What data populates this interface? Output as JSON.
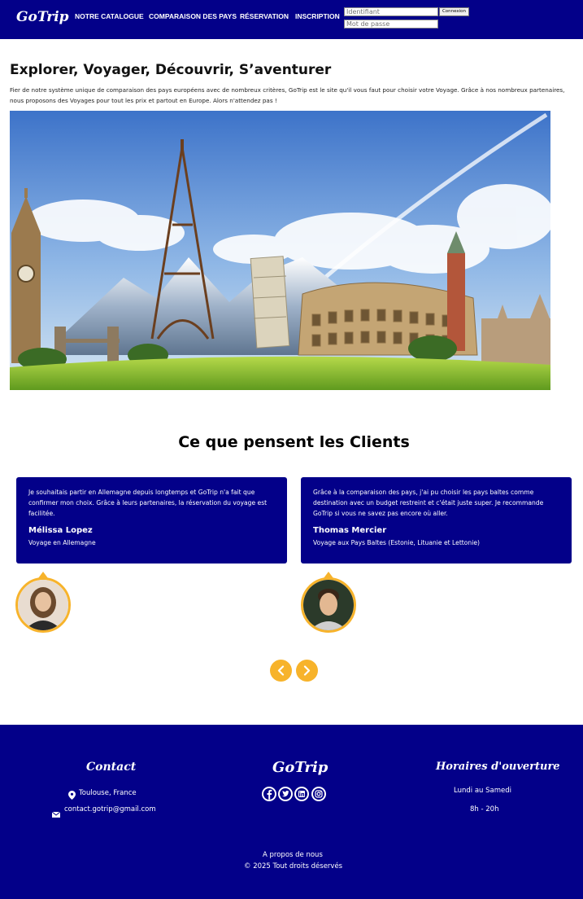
{
  "navbar": {
    "logo": "GoTrip",
    "links": [
      "NOTRE CATALOGUE",
      "COMPARAISON DES PAYS",
      "RÉSERVATION",
      "INSCRIPTION"
    ],
    "login": {
      "username_placeholder": "Identifiant",
      "password_placeholder": "Mot de passe",
      "submit_label": "Connexion"
    },
    "bg_color": "#030089"
  },
  "hero": {
    "title": "Explorer, Voyager, Découvrir, S’aventurer",
    "description": "Fier de notre système unique de comparaison des pays européens avec de nombreux critères, GoTrip est le site qu'il vous faut pour choisir votre Voyage. Grâce à nos nombreux partenaires, nous proposons des Voyages pour tout les prix et partout en Europe. Alors n'attendez pas !"
  },
  "testimonials": {
    "title": "Ce que pensent les Clients",
    "items": [
      {
        "quote": "Je souhaitais partir en Allemagne depuis longtemps et GoTrip n'a fait que confirmer mon choix. Grâce à leurs partenaires, la réservation du voyage est facilitée.",
        "name": "Mélissa Lopez",
        "trip": "Voyage en Allemagne",
        "avatar_icon": "woman-avatar-icon"
      },
      {
        "quote": "Grâce à la comparaison des pays, j'ai pu choisir les pays baltes comme destination avec un budget restreint et c'était juste super. Je recommande GoTrip si vous ne savez pas encore où aller.",
        "name": "Thomas Mercier",
        "trip": "Voyage aux Pays Baltes (Estonie, Lituanie et Lettonie)",
        "avatar_icon": "man-avatar-icon"
      }
    ],
    "accent_color": "#f7b32b"
  },
  "footer": {
    "contact": {
      "title": "Contact",
      "location": "Toulouse, France",
      "email": "contact.gotrip@gmail.com"
    },
    "brand": {
      "logo": "GoTrip",
      "socials": [
        "facebook-icon",
        "twitter-icon",
        "linkedin-icon",
        "instagram-icon"
      ]
    },
    "hours": {
      "title": "Horaires d'ouverture",
      "days": "Lundi au Samedi",
      "time": "8h - 20h"
    },
    "about": "A propos de nous",
    "copyright": "© 2025 Tout droits déservés"
  }
}
